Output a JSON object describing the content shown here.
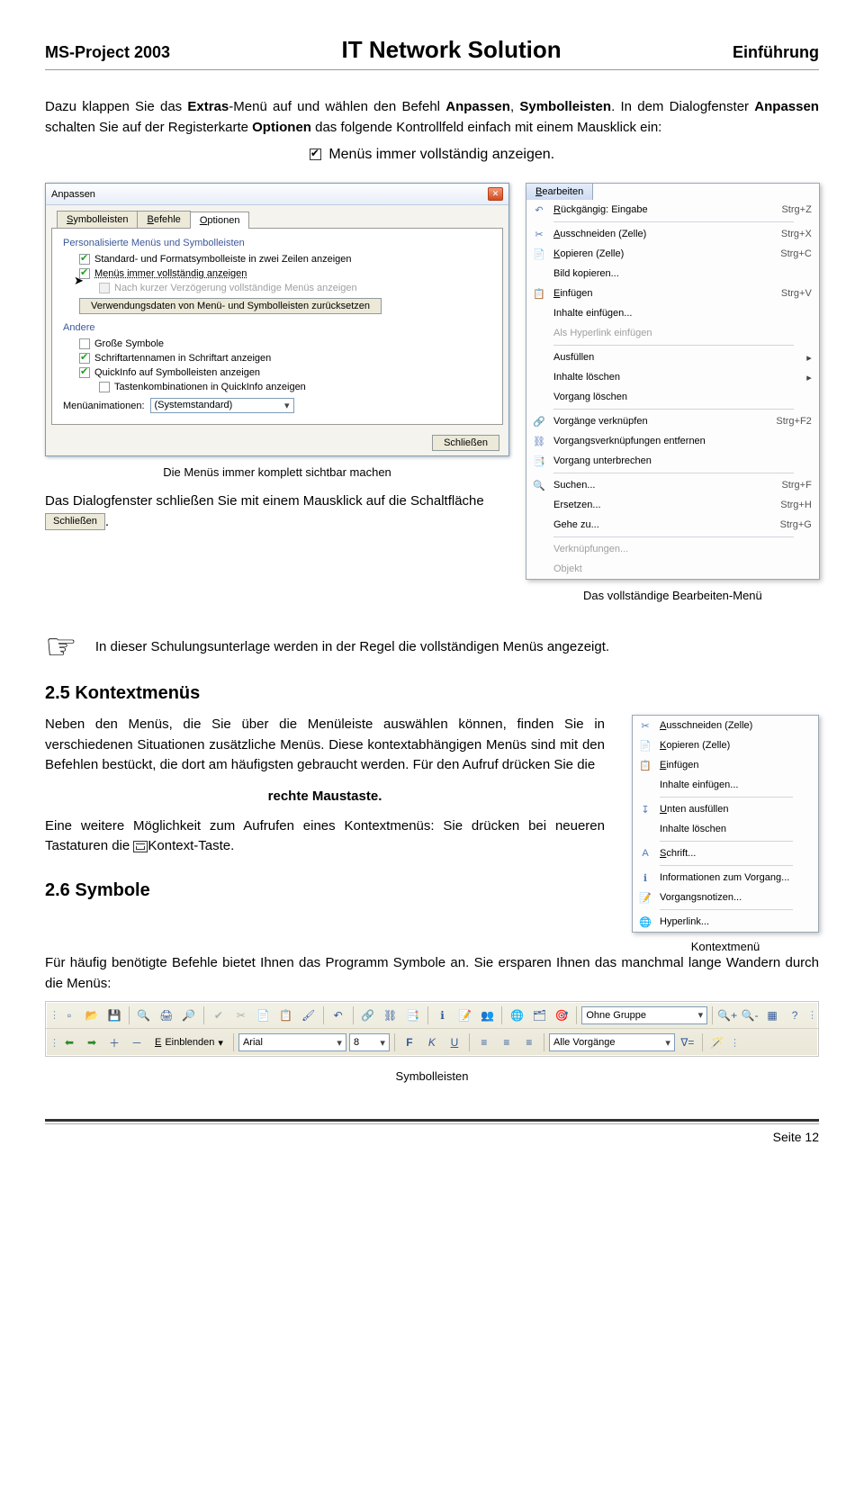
{
  "header": {
    "left": "MS-Project 2003",
    "center": "IT Network Solution",
    "right": "Einführung"
  },
  "intro": {
    "p1a": "Dazu klappen Sie das ",
    "p1b": "Extras",
    "p1c": "-Menü auf und wählen den Befehl ",
    "p1d": "Anpassen",
    "p1e": ", ",
    "p1f": "Symbolleisten",
    "p1g": ". In dem Dialogfenster ",
    "p1h": "Anpassen",
    "p1i": " schalten Sie auf der Registerkarte ",
    "p1j": "Optionen",
    "p1k": " das folgende Kontrollfeld einfach mit einem Mausklick ein:",
    "cb_label": "Menüs immer vollständig anzeigen."
  },
  "dialog": {
    "title": "Anpassen",
    "tabs": {
      "t1": "Symbolleisten",
      "t2": "Befehle",
      "t3": "Optionen"
    },
    "grp1": "Personalisierte Menüs und Symbolleisten",
    "opt1": "Standard- und Formatsymbolleiste in zwei Zeilen anzeigen",
    "opt2": "Menüs immer vollständig anzeigen",
    "opt3": "Nach kurzer Verzögerung vollständige Menüs anzeigen",
    "btn_reset": "Verwendungsdaten von Menü- und Symbolleisten zurücksetzen",
    "grp2": "Andere",
    "opt4": "Große Symbole",
    "opt5": "Schriftartennamen in Schriftart anzeigen",
    "opt6": "QuickInfo auf Symbolleisten anzeigen",
    "opt7": "Tastenkombinationen in QuickInfo anzeigen",
    "anim_lbl": "Menüanimationen:",
    "anim_val": "(Systemstandard)",
    "btn_close": "Schließen"
  },
  "fig1_caption": "Die Menüs immer komplett sichtbar machen",
  "below_fig1": {
    "a": "Das Dialogfenster schließen Sie mit einem Mausklick auf die Schaltfläche ",
    "btn": "Schließen",
    "b": "."
  },
  "right_menu": {
    "tab": "Bearbeiten",
    "items": [
      {
        "icon": "↶",
        "label_pre": "R",
        "label": "ückgängig: Eingabe",
        "short": "Strg+Z"
      },
      {
        "sep": true
      },
      {
        "icon": "✂",
        "label_pre": "A",
        "label": "usschneiden (Zelle)",
        "short": "Strg+X"
      },
      {
        "icon": "📄",
        "label_pre": "K",
        "label": "opieren (Zelle)",
        "short": "Strg+C"
      },
      {
        "icon": "",
        "label_pre": "",
        "label": "Bild kopieren...",
        "short": ""
      },
      {
        "icon": "📋",
        "label_pre": "E",
        "label": "infügen",
        "short": "Strg+V"
      },
      {
        "icon": "",
        "label_pre": "",
        "label": "Inhalte einfügen...",
        "short": ""
      },
      {
        "icon": "",
        "label_pre": "",
        "label": "Als Hyperlink einfügen",
        "short": "",
        "disabled": true
      },
      {
        "sep": true
      },
      {
        "icon": "",
        "label_pre": "",
        "label": "Ausfüllen",
        "sub": true
      },
      {
        "icon": "",
        "label_pre": "",
        "label": "Inhalte löschen",
        "sub": true
      },
      {
        "icon": "",
        "label_pre": "",
        "label": "Vorgang löschen"
      },
      {
        "sep": true
      },
      {
        "icon": "🔗",
        "label_pre": "",
        "label": "Vorgänge verknüpfen",
        "short": "Strg+F2"
      },
      {
        "icon": "⛓",
        "label_pre": "",
        "label": "Vorgangsverknüpfungen entfernen"
      },
      {
        "icon": "📑",
        "label_pre": "",
        "label": "Vorgang unterbrechen"
      },
      {
        "sep": true
      },
      {
        "icon": "🔍",
        "label_pre": "",
        "label": "Suchen...",
        "short": "Strg+F"
      },
      {
        "icon": "",
        "label_pre": "",
        "label": "Ersetzen...",
        "short": "Strg+H"
      },
      {
        "icon": "",
        "label_pre": "",
        "label": "Gehe zu...",
        "short": "Strg+G"
      },
      {
        "sep": true
      },
      {
        "icon": "",
        "label_pre": "",
        "label": "Verknüpfungen...",
        "disabled": true
      },
      {
        "icon": "",
        "label_pre": "",
        "label": "Objekt",
        "disabled": true
      }
    ],
    "caption": "Das vollständige Bearbeiten-Menü"
  },
  "note": "In dieser Schulungsunterlage werden in der Regel die vollständigen Menüs angezeigt.",
  "sec25": {
    "heading": "2.5    Kontextmenüs",
    "p1": "Neben den Menüs, die Sie über die Menüleiste auswählen können, finden Sie in verschiedenen Situationen zusätzliche Menüs. Diese kontextabhängigen Menüs sind mit den Befehlen bestückt, die dort am häufigsten gebraucht werden. Für den Aufruf drücken Sie die",
    "bold_center": "rechte Maustaste.",
    "p2a": "Eine weitere Möglichkeit zum Aufrufen eines Kontextmenüs: Sie drücken bei neueren Tastaturen die ",
    "p2b": "Kontext-Taste."
  },
  "ctx": {
    "items": [
      {
        "icon": "✂",
        "label_pre": "A",
        "label": "usschneiden (Zelle)"
      },
      {
        "icon": "📄",
        "label_pre": "K",
        "label": "opieren (Zelle)"
      },
      {
        "icon": "📋",
        "label_pre": "E",
        "label": "infügen"
      },
      {
        "icon": "",
        "label": "Inhalte einfügen..."
      },
      {
        "sep": true
      },
      {
        "icon": "↧",
        "label_pre": "U",
        "label": "nten ausfüllen"
      },
      {
        "icon": "",
        "label": "Inhalte löschen"
      },
      {
        "sep": true
      },
      {
        "icon": "A",
        "label_pre": "S",
        "label": "chrift..."
      },
      {
        "sep": true
      },
      {
        "icon": "ℹ",
        "label": "Informationen zum Vorgang..."
      },
      {
        "icon": "📝",
        "label_pre": "",
        "label": "Vorgangsnotizen..."
      },
      {
        "sep": true
      },
      {
        "icon": "🌐",
        "label_pre": "",
        "label": "Hyperlink..."
      }
    ],
    "caption": "Kontextmenü"
  },
  "sec26": {
    "heading": "2.6    Symbole",
    "p": "Für häufig benötigte Befehle bietet Ihnen das Programm Symbole an. Sie ersparen Ihnen das manchmal lange Wandern durch die Menüs:",
    "caption": "Symbolleisten"
  },
  "toolbar": {
    "row1_combo": "Ohne Gruppe",
    "row2_btn": "Einblenden",
    "row2_font": "Arial",
    "row2_size": "8",
    "row2_filter": "Alle Vorgänge",
    "bold": "F",
    "italic": "K",
    "underline": "U"
  },
  "footer": "Seite 12"
}
